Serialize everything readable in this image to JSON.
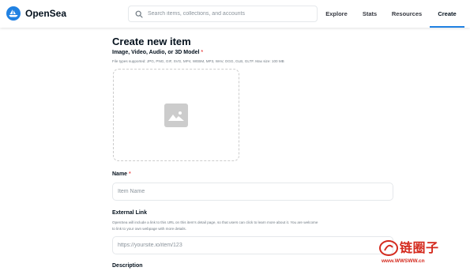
{
  "header": {
    "brand": "OpenSea",
    "search_placeholder": "Search items, collections, and accounts",
    "nav": {
      "explore": "Explore",
      "stats": "Stats",
      "resources": "Resources",
      "create": "Create"
    },
    "active_nav": "Create",
    "accent_color": "#2081e2"
  },
  "form": {
    "title": "Create new item",
    "media": {
      "label": "Image, Video, Audio, or 3D Model",
      "required_mark": "*",
      "help": "File types supported: JPG, PNG, GIF, SVG, MP4, WEBM, MP3, WAV, OGG, GLB, GLTF. Max size: 100 MB",
      "icon": "image-icon"
    },
    "name": {
      "label": "Name",
      "required_mark": "*",
      "placeholder": "Item Name"
    },
    "external_link": {
      "label": "External Link",
      "help_line1": "OpenSea will include a link to this URL on this item's detail page, so that users can click to learn more about it. You are welcome",
      "help_line2": "to link to your own webpage with more details.",
      "placeholder": "https://yoursite.io/item/123"
    },
    "description": {
      "label": "Description"
    }
  },
  "watermark": {
    "brand": "链圈子",
    "url": "www.WWSWW.cn"
  }
}
